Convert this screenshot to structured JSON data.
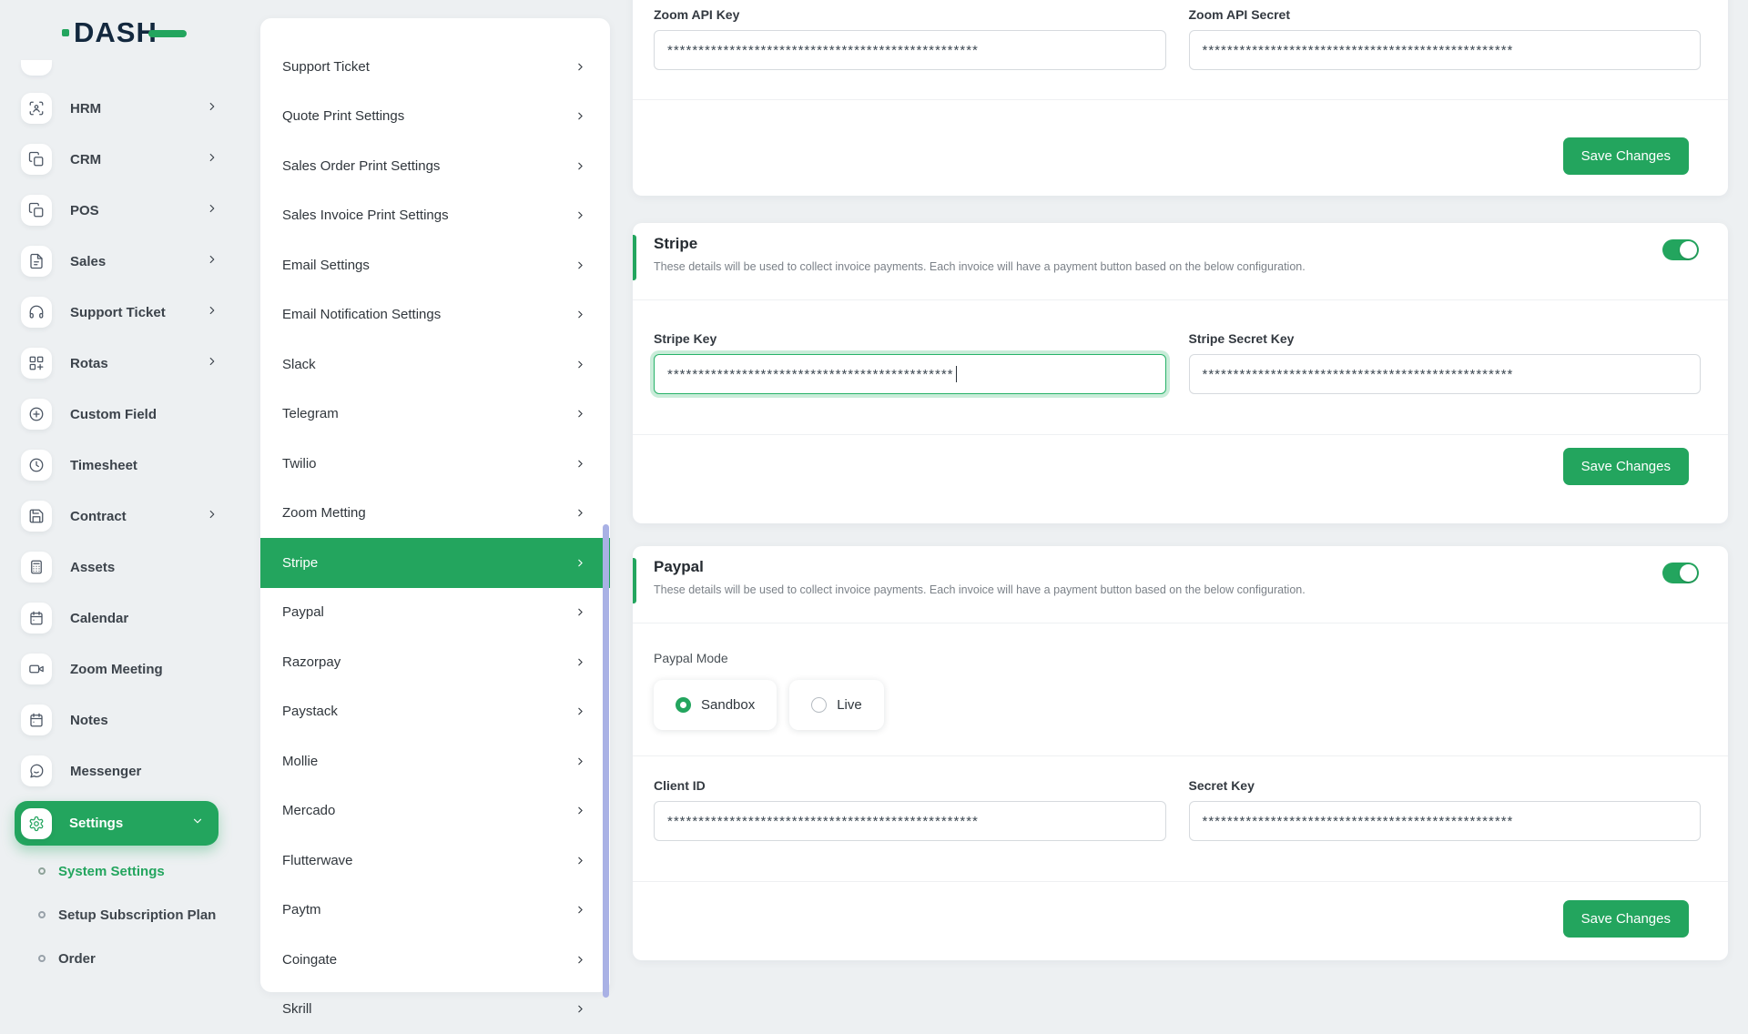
{
  "brand": {
    "name": "DASH"
  },
  "colors": {
    "primary": "#23a55e",
    "scrollbar_thumb": "#a9b1e5"
  },
  "sidebar": {
    "items": [
      {
        "label": "HRM",
        "icon": "scan-user-icon",
        "chevron": true
      },
      {
        "label": "CRM",
        "icon": "copy-icon",
        "chevron": true
      },
      {
        "label": "POS",
        "icon": "copy-icon",
        "chevron": true
      },
      {
        "label": "Sales",
        "icon": "file-text-icon",
        "chevron": true
      },
      {
        "label": "Support Ticket",
        "icon": "headphones-icon",
        "chevron": true
      },
      {
        "label": "Rotas",
        "icon": "grid-plus-icon",
        "chevron": true
      },
      {
        "label": "Custom Field",
        "icon": "circle-plus-icon",
        "chevron": false
      },
      {
        "label": "Timesheet",
        "icon": "clock-icon",
        "chevron": false
      },
      {
        "label": "Contract",
        "icon": "save-icon",
        "chevron": true
      },
      {
        "label": "Assets",
        "icon": "calculator-icon",
        "chevron": false
      },
      {
        "label": "Calendar",
        "icon": "calendar-icon",
        "chevron": false
      },
      {
        "label": "Zoom Meeting",
        "icon": "video-icon",
        "chevron": false
      },
      {
        "label": "Notes",
        "icon": "calendar-icon",
        "chevron": false
      },
      {
        "label": "Messenger",
        "icon": "chat-icon",
        "chevron": false
      }
    ],
    "settings": {
      "label": "Settings"
    },
    "settings_children": [
      {
        "label": "System Settings",
        "active": true
      },
      {
        "label": "Setup Subscription Plan",
        "active": false
      },
      {
        "label": "Order",
        "active": false
      }
    ]
  },
  "settings_nav": {
    "items": [
      {
        "label": "Support Ticket",
        "active": false
      },
      {
        "label": "Quote Print Settings",
        "active": false
      },
      {
        "label": "Sales Order Print Settings",
        "active": false
      },
      {
        "label": "Sales Invoice Print Settings",
        "active": false
      },
      {
        "label": "Email Settings",
        "active": false
      },
      {
        "label": "Email Notification Settings",
        "active": false
      },
      {
        "label": "Slack",
        "active": false
      },
      {
        "label": "Telegram",
        "active": false
      },
      {
        "label": "Twilio",
        "active": false
      },
      {
        "label": "Zoom Metting",
        "active": false
      },
      {
        "label": "Stripe",
        "active": true
      },
      {
        "label": "Paypal",
        "active": false
      },
      {
        "label": "Razorpay",
        "active": false
      },
      {
        "label": "Paystack",
        "active": false
      },
      {
        "label": "Mollie",
        "active": false
      },
      {
        "label": "Mercado",
        "active": false
      },
      {
        "label": "Flutterwave",
        "active": false
      },
      {
        "label": "Paytm",
        "active": false
      },
      {
        "label": "Coingate",
        "active": false
      },
      {
        "label": "Skrill",
        "active": false
      }
    ]
  },
  "content": {
    "zoom_section": {
      "fields": [
        {
          "label": "Zoom API Key",
          "value": "**************************************************"
        },
        {
          "label": "Zoom API Secret",
          "value": "**************************************************"
        }
      ],
      "save_label": "Save Changes"
    },
    "stripe_section": {
      "title": "Stripe",
      "enabled": true,
      "description": "These details will be used to collect invoice payments. Each invoice will have a payment button based on the below configuration.",
      "fields": [
        {
          "label": "Stripe Key",
          "value": "**********************************************"
        },
        {
          "label": "Stripe Secret Key",
          "value": "**************************************************"
        }
      ],
      "save_label": "Save Changes"
    },
    "paypal_section": {
      "title": "Paypal",
      "enabled": true,
      "description": "These details will be used to collect invoice payments. Each invoice will have a payment button based on the below configuration.",
      "mode_label": "Paypal Mode",
      "modes": [
        {
          "label": "Sandbox",
          "selected": true
        },
        {
          "label": "Live",
          "selected": false
        }
      ],
      "fields": [
        {
          "label": "Client ID",
          "value": "**************************************************"
        },
        {
          "label": "Secret Key",
          "value": "**************************************************"
        }
      ],
      "save_label": "Save Changes"
    }
  }
}
